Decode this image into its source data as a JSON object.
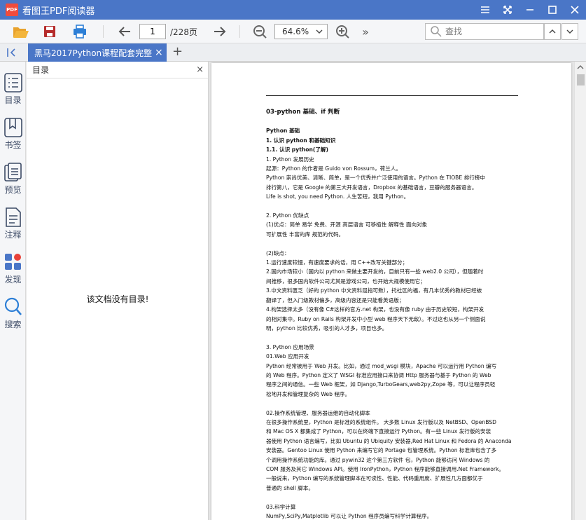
{
  "window": {
    "app_title": "看图王PDF阅读器",
    "logo_text": "PDF"
  },
  "toolbar": {
    "page_current": "1",
    "page_total": "/228页",
    "zoom": "64.6%",
    "search_placeholder": "查找",
    "more": "»"
  },
  "tabs": {
    "active_label": "黑马2017Python课程配套完整版",
    "close": "×",
    "add": "+"
  },
  "rail": {
    "items": [
      "目录",
      "书签",
      "预览",
      "注释",
      "发现",
      "搜索"
    ]
  },
  "toc": {
    "title": "目录",
    "close": "×",
    "empty_message": "该文档没有目录!"
  },
  "document": {
    "heading": "03-python 基础、if 判断",
    "lines": [
      {
        "t": "Python 基础",
        "s": "h"
      },
      {
        "t": "1.  认识 python 和基础知识",
        "s": "h"
      },
      {
        "t": "1.1.  认识 python(了解)",
        "s": "h"
      },
      {
        "t": "1. Python 发展历史",
        "s": ""
      },
      {
        "t": "起源：Python 的作者是 Guido von Rossum，荷兰人。",
        "s": ""
      },
      {
        "t": "Python 崇尚优美、清晰、简单，是一个优秀并广泛使用的语言。Python 在 TIOBE 排行榜中",
        "s": ""
      },
      {
        "t": "排行第八，它是 Google 的第三大开发语言，Dropbox 的基础语言，豆瓣的服务器语言。",
        "s": ""
      },
      {
        "t": "Life is shot, you need Python.      人生苦短，我用 Python。",
        "s": ""
      },
      {
        "t": "",
        "s": "gap"
      },
      {
        "t": "2. Python 优缺点",
        "s": ""
      },
      {
        "t": "(1)优点：简单       易学       免费、开源       高层语言       可移植性       解释性       面向对象",
        "s": ""
      },
      {
        "t": "可扩展性       丰富的库       规范的代码。",
        "s": ""
      },
      {
        "t": "",
        "s": "gap"
      },
      {
        "t": "(2)缺点：",
        "s": ""
      },
      {
        "t": "1.运行速度较慢，有速度要求的话，用 C++改写关键部分；",
        "s": ""
      },
      {
        "t": "2.国内市场较小（国内以 python 来做主要开发的，目前只有一些 web2.0 公司），但随着时",
        "s": ""
      },
      {
        "t": "间推移，很多国内软件公司尤其是游戏公司，也开始大规模使用它；",
        "s": ""
      },
      {
        "t": "3.中文资料匮乏（好的 python 中文资料屈指可数），托社区的福，有几本优秀的教材已经被",
        "s": ""
      },
      {
        "t": "翻译了，但入门级教材偏多，高级内容还是只能看英语版；",
        "s": ""
      },
      {
        "t": "4.构架选择太多（没有像 C#这样的官方.net 构架，也没有像 ruby 由于历史较短，构架开发",
        "s": ""
      },
      {
        "t": "的相对集中。Ruby on Rails  构架开发中小型 web 程序天下无敌）。不过这也从另一个侧面说",
        "s": ""
      },
      {
        "t": "明，python 比较优秀，吸引的人才多，项目也多。",
        "s": ""
      },
      {
        "t": "",
        "s": "gap"
      },
      {
        "t": "3. Python 应用场景",
        "s": ""
      },
      {
        "t": "01.Web 应用开发",
        "s": ""
      },
      {
        "t": "Python 经常被用于 Web 开发。比如，通过 mod_wsgi 模块，Apache 可以运行用 Python 编写",
        "s": ""
      },
      {
        "t": "的 Web 程序。Python 定义了 WSGI 标准应用接口来协调 Http 服务器与基于 Python 的 Web",
        "s": ""
      },
      {
        "t": "程序之间的通信。一些 Web 框架，如 Django,TurboGears,web2py,Zope 等，可以让程序员轻",
        "s": ""
      },
      {
        "t": "松地开发和管理复杂的 Web 程序。",
        "s": ""
      },
      {
        "t": "",
        "s": "gap"
      },
      {
        "t": "02.操作系统管理、服务器运维的自动化脚本",
        "s": ""
      },
      {
        "t": "在很多操作系统里，Python 是标准的系统组件。 大多数 Linux 发行版以及 NetBSD、OpenBSD",
        "s": ""
      },
      {
        "t": "和 Mac OS X 都集成了 Python，可以在终端下直接运行 Python。有一些 Linux 发行版的安装",
        "s": ""
      },
      {
        "t": "器使用 Python 语言编写，比如 Ubuntu 的 Ubiquity 安装器,Red Hat Linux 和 Fedora 的 Anaconda",
        "s": ""
      },
      {
        "t": "安装器。Gentoo Linux 使用 Python 来编写它的 Portage 包管理系统。Python 标准库包含了多",
        "s": ""
      },
      {
        "t": "个调用操作系统功能的库。通过 pywin32 这个第三方软件 包，Python 能够访问 Windows 的",
        "s": ""
      },
      {
        "t": "COM 服务及其它 Windows API。使用 IronPython，Python 程序能够直接调用.Net Framework。",
        "s": ""
      },
      {
        "t": "一般说来，Python 编写的系统管理脚本在可读性、性能、代码重用度、扩展性几方面都优于",
        "s": ""
      },
      {
        "t": "普通的 shell 脚本。",
        "s": ""
      },
      {
        "t": "",
        "s": "gap"
      },
      {
        "t": "03.科学计算",
        "s": ""
      },
      {
        "t": "NumPy,SciPy,Matplotlib 可以让 Python 程序员编写科学计算程序。",
        "s": ""
      }
    ]
  },
  "colors": {
    "accent": "#4a76c7",
    "icon_blue": "#2d7fd6",
    "icon_orange": "#e8a22d",
    "icon_red": "#c0392b",
    "discover_red": "#e8423a"
  }
}
